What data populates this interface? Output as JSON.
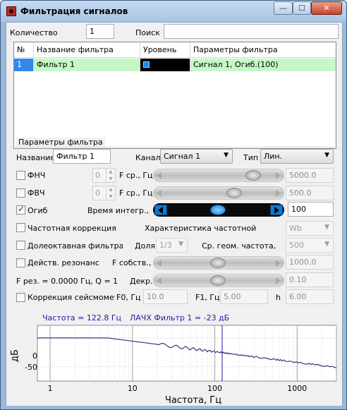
{
  "window": {
    "title": "Фильтрация сигналов",
    "min": "—",
    "max": "☐",
    "close": "✕"
  },
  "top": {
    "count_label": "Количество",
    "count_value": "1",
    "search_label": "Поиск",
    "search_value": ""
  },
  "grid": {
    "headers": [
      "№",
      "Название фильтра",
      "Уровень",
      "Параметры фильтра"
    ],
    "rows": [
      {
        "num": "1",
        "name": "Фильтр 1",
        "params": "Сигнал 1, Огиб.(100)"
      }
    ]
  },
  "params": {
    "group_title": "Параметры фильтра",
    "name_label": "Название",
    "name_value": "Фильтр 1",
    "channel_label": "Канал",
    "channel_value": "Сигнал 1",
    "type_label": "Тип",
    "type_value": "Лин.",
    "lowpass": {
      "label": "ФНЧ",
      "spin": "0",
      "freq_label": "F ср., Гц",
      "value": "5000.0",
      "slider": 0.85
    },
    "highpass": {
      "label": "ФВЧ",
      "spin": "0",
      "freq_label": "F ср., Гц",
      "value": "500.0",
      "slider": 0.66
    },
    "envelope": {
      "label": "Огиб",
      "time_label": "Время интегр.,",
      "value": "100",
      "slider": 0.5
    },
    "freqcorr": {
      "label": "Частотная коррекция",
      "char_label": "Характеристика частотной",
      "char_value": "Wb"
    },
    "octave": {
      "label": "Долеоктавная фильтрация",
      "share_label": "Доля",
      "share_value": "1/3",
      "geo_label": "Ср. геом. частота,",
      "geo_value": "500"
    },
    "resonance": {
      "label": "Действ. резонанс",
      "freq_label": "F собств., Гц",
      "value": "1000.0",
      "decr_label": "Декр.",
      "decr_value": "0.10",
      "slider": 0.5,
      "slider2": 0.5
    },
    "fres_text": "F рез. = 0.0000 Гц, Q = 1",
    "seismo": {
      "label": "Коррекция сейсмометр",
      "f0_label": "F0, Гц",
      "f0_value": "10.0",
      "f1_label": "F1, Гц",
      "f1_value": "5.00",
      "h_label": "h",
      "h_value": "6.00"
    }
  },
  "plot": {
    "freq_text": "Частота = 122.8 Гц",
    "afc_text": "ЛАЧХ Фильтр 1 = -23 дБ",
    "ylabel": "дБ",
    "xlabel": "Частота, Гц",
    "yticks": [
      "0",
      "-50"
    ],
    "xticks": [
      "1",
      "10",
      "100",
      "1000"
    ]
  },
  "colors": {
    "row_bg": "#c6f7c6",
    "accent": "#0a7ad6",
    "plot_line": "#2b3a7c",
    "cursor": "#1d1da8"
  }
}
